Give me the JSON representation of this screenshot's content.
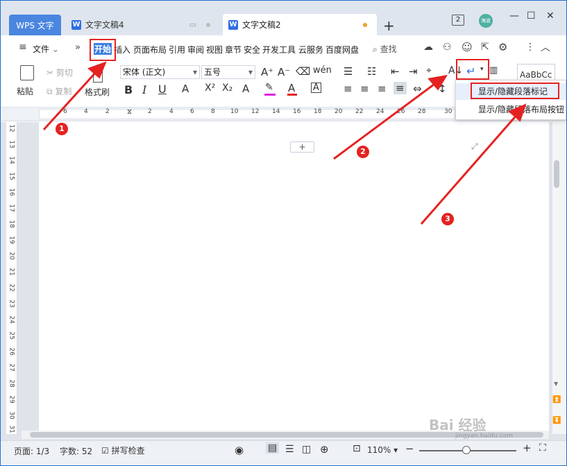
{
  "tabs": {
    "app": "WPS 文字",
    "doc4": "文字文稿4",
    "doc2": "文字文稿2",
    "new_tab": "+"
  },
  "titlebar": {
    "page_count": "2",
    "avatar_text": "海波",
    "min": "—",
    "max": "☐",
    "close": "✕"
  },
  "menu": {
    "hamburger": "≡",
    "file": "文件",
    "more": "»",
    "items": [
      "开始",
      "插入",
      "页面布局",
      "引用",
      "审阅",
      "视图",
      "章节",
      "安全",
      "开发工具",
      "云服务",
      "百度网盘"
    ],
    "search": "查找"
  },
  "ribbon": {
    "paste": "粘贴",
    "cut": "剪切",
    "copy": "复制",
    "format_painter": "格式刷",
    "font_name": "宋体 (正文)",
    "font_size": "五号",
    "style_preview": "AaBbCc"
  },
  "ruler": {
    "h_ticks": [
      "6",
      "4",
      "2",
      "",
      "2",
      "4",
      "6",
      "8",
      "10",
      "12",
      "14",
      "16",
      "18",
      "20",
      "22",
      "24",
      "26",
      "28",
      "30"
    ],
    "v_ticks": [
      "12",
      "13",
      "14",
      "15",
      "16",
      "17",
      "18",
      "19",
      "20",
      "21",
      "22",
      "23",
      "24",
      "25",
      "26",
      "27",
      "28",
      "29",
      "30",
      "31"
    ]
  },
  "page": {
    "add_paragraph": "+"
  },
  "dropdown": {
    "item1": "显示/隐藏段落标记",
    "item2": "显示/隐藏段落布局按钮"
  },
  "statusbar": {
    "page": "页面: 1/3",
    "words": "字数: 52",
    "spellcheck": "拼写检查",
    "zoom": "110%"
  },
  "annotations": {
    "m1": "1",
    "m2": "2",
    "m3": "3"
  },
  "watermark": {
    "main": "Bai 经验",
    "sub": "jingyan.baidu.com"
  },
  "colors": {
    "accent": "#4a86e0",
    "annotation": "#e52222",
    "highlight_bar": "#e020e0",
    "font_color_bar": "#e52222"
  }
}
